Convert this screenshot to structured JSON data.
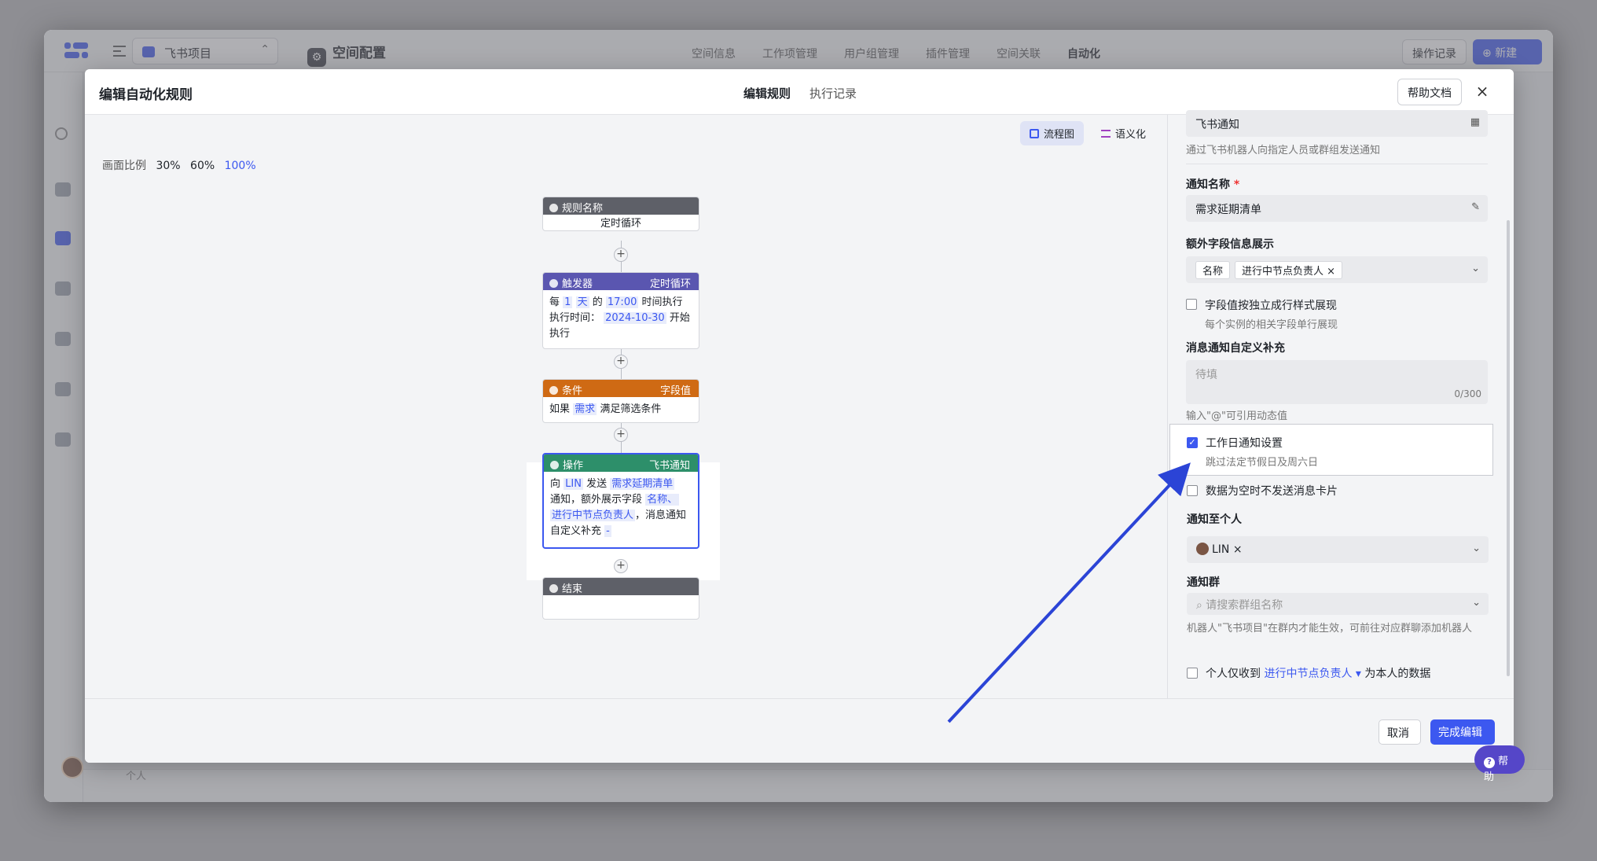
{
  "app": {
    "project": "飞书项目",
    "space_title": "空间配置",
    "top_tabs": [
      "空间信息",
      "工作项管理",
      "用户组管理",
      "插件管理",
      "空间关联",
      "自动化"
    ],
    "log_button": "操作记录",
    "new_button": "新建",
    "personal_label": "个人"
  },
  "modal": {
    "title": "编辑自动化规则",
    "tabs": [
      "编辑规则",
      "执行记录"
    ],
    "help_doc": "帮助文档",
    "close": "×"
  },
  "canvas": {
    "view_flow": "流程图",
    "view_semantic": "语义化",
    "scale_label": "画面比例",
    "scales": [
      "30%",
      "60%",
      "100%"
    ],
    "nodes": {
      "rule": {
        "head": "规则名称",
        "body": "定时循环"
      },
      "trigger": {
        "head": "触发器",
        "head_right": "定时循环",
        "t1": "每",
        "v1": "1",
        "v2": "天",
        "t2": "的",
        "v3": "17:00",
        "t3": "时间执行",
        "t4": "执行时间：",
        "v4": "2024-10-30",
        "t5": "开始执行"
      },
      "condition": {
        "head": "条件",
        "head_right": "字段值",
        "t1": "如果",
        "v1": "需求",
        "t2": "满足筛选条件"
      },
      "action": {
        "head": "操作",
        "head_right": "飞书通知",
        "t1": "向",
        "v1": "LIN",
        "t2": "发送",
        "v2": "需求延期清单",
        "t3": "通知，额外展示字段",
        "v3": "名称、",
        "v4": "进行中节点负责人",
        "t4": "，消息通知自定义补充",
        "v5": "-"
      },
      "end": {
        "head": "结束"
      }
    }
  },
  "panel": {
    "channel_value": "飞书通知",
    "channel_desc": "通过飞书机器人向指定人员或群组发送通知",
    "notify_name_label": "通知名称",
    "notify_name_required": "*",
    "notify_name_value": "需求延期清单",
    "extra_fields_label": "额外字段信息展示",
    "extra_fields": [
      "名称",
      "进行中节点负责人"
    ],
    "independent_style_label": "字段值按独立成行样式展现",
    "independent_style_desc": "每个实例的相关字段单行展现",
    "custom_label": "消息通知自定义补充",
    "custom_placeholder": "待填",
    "custom_count": "0/300",
    "custom_hint": "输入\"@\"可引用动态值",
    "workday_label": "工作日通知设置",
    "workday_desc": "跳过法定节假日及周六日",
    "empty_label": "数据为空时不发送消息卡片",
    "to_person_label": "通知至个人",
    "to_person_value": "LIN",
    "group_label": "通知群",
    "group_placeholder": "请搜索群组名称",
    "group_hint": "机器人\"飞书项目\"在群内才能生效，可前往对应群聊添加机器人",
    "personal_only_t1": "个人仅收到",
    "personal_only_field": "进行中节点负责人",
    "personal_only_t2": "为本人的数据"
  },
  "footer": {
    "cancel": "取消",
    "done": "完成编辑",
    "help": "帮助"
  },
  "colors": {
    "accent": "#3c58f0",
    "arrow": "#2b44d6"
  }
}
